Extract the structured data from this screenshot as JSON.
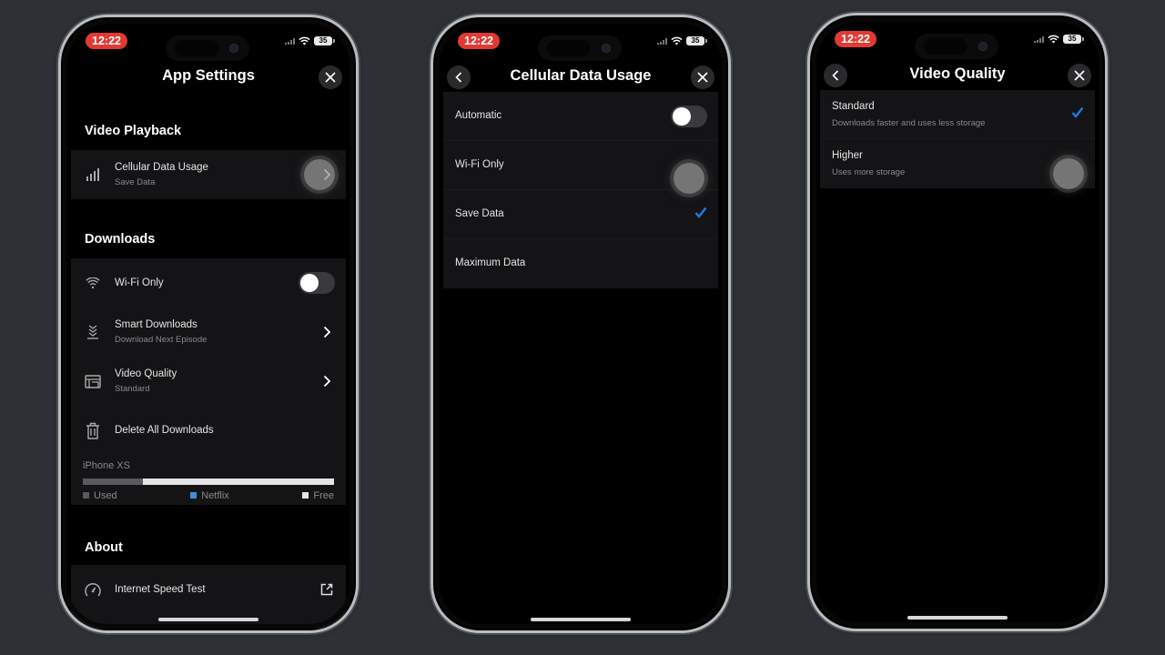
{
  "status_bar": {
    "time": "12:22",
    "battery": "35"
  },
  "screens": {
    "app_settings": {
      "title": "App Settings",
      "sections": {
        "video_playback": {
          "heading": "Video Playback",
          "cellular": {
            "label": "Cellular Data Usage",
            "value": "Save Data"
          }
        },
        "downloads": {
          "heading": "Downloads",
          "wifi_only": {
            "label": "Wi-Fi Only",
            "enabled": false
          },
          "smart_downloads": {
            "label": "Smart Downloads",
            "value": "Download Next Episode"
          },
          "video_quality": {
            "label": "Video Quality",
            "value": "Standard"
          },
          "delete_all": {
            "label": "Delete All Downloads"
          },
          "storage": {
            "device": "iPhone XS",
            "used_fraction": 0.24,
            "netflix_fraction": 0.0,
            "legend": {
              "used": "Used",
              "netflix": "Netflix",
              "free": "Free"
            },
            "colors": {
              "used": "#5a5a5c",
              "netflix": "#3d8fe0",
              "free": "#e5e5e5"
            }
          }
        },
        "about": {
          "heading": "About",
          "speed_test": {
            "label": "Internet Speed Test"
          }
        }
      }
    },
    "cellular_data_usage": {
      "title": "Cellular Data Usage",
      "automatic": {
        "label": "Automatic",
        "enabled": false
      },
      "options": [
        {
          "label": "Wi-Fi Only",
          "selected": false
        },
        {
          "label": "Save Data",
          "selected": true
        },
        {
          "label": "Maximum Data",
          "selected": false
        }
      ]
    },
    "video_quality": {
      "title": "Video Quality",
      "options": [
        {
          "label": "Standard",
          "description": "Downloads faster and uses less storage",
          "selected": true
        },
        {
          "label": "Higher",
          "description": "Uses more storage",
          "selected": false
        }
      ]
    }
  },
  "colors": {
    "accent_check": "#1f7ae0",
    "time_pill": "#e03a32",
    "background": "#2d3135"
  }
}
